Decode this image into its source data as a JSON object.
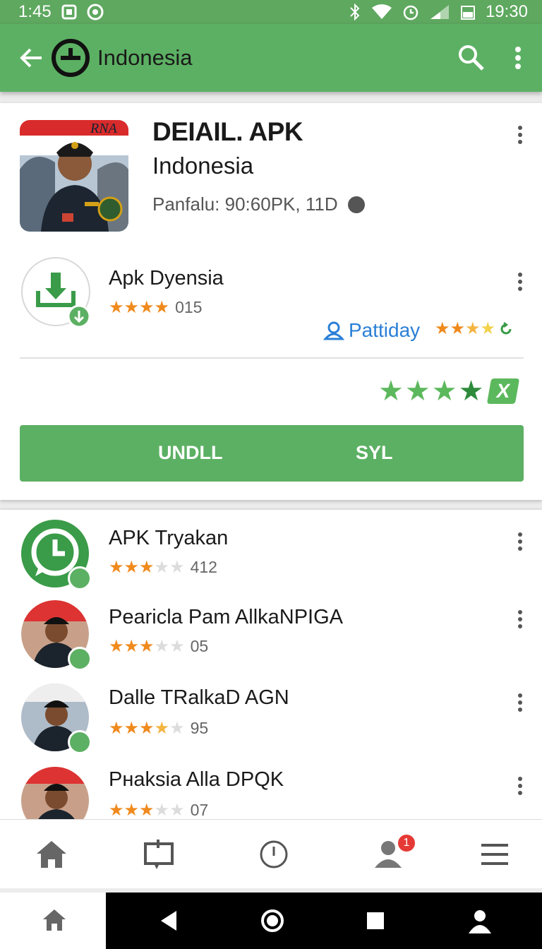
{
  "status_bar": {
    "time_left": "1:45",
    "time_right": "19:30"
  },
  "app_bar": {
    "title": "Indonesia"
  },
  "detail": {
    "title": "DEIAIL. APK",
    "subtitle": "Indonesia",
    "meta": "Panfalu: 90:60PK, 11D"
  },
  "featured": {
    "title": "Apk Dyensia",
    "rating_stars": 4,
    "count": "015",
    "publisher": "Pattiday",
    "publisher_rating_stars": 3
  },
  "overall_rating_stars": 4,
  "actions": {
    "primary": "UNDLL",
    "secondary": "SYL"
  },
  "list": [
    {
      "title": "APK Tryakan",
      "rating_stars": 3,
      "count": "412"
    },
    {
      "title": "Pearicla Pam AllkaNPIGA",
      "rating_stars": 3,
      "count": "05"
    },
    {
      "title": "Dalle TRalkaD AGN",
      "rating_stars": 3.5,
      "count": "95"
    },
    {
      "title": "Pнaksia Alla DPQK",
      "rating_stars": 3,
      "count": "07"
    }
  ],
  "bottom_nav": {
    "notification_count": "1"
  },
  "colors": {
    "primary_green": "#5cb063",
    "star_orange": "#f08a1d",
    "link_blue": "#2a7fd6",
    "badge_red": "#e53935"
  }
}
